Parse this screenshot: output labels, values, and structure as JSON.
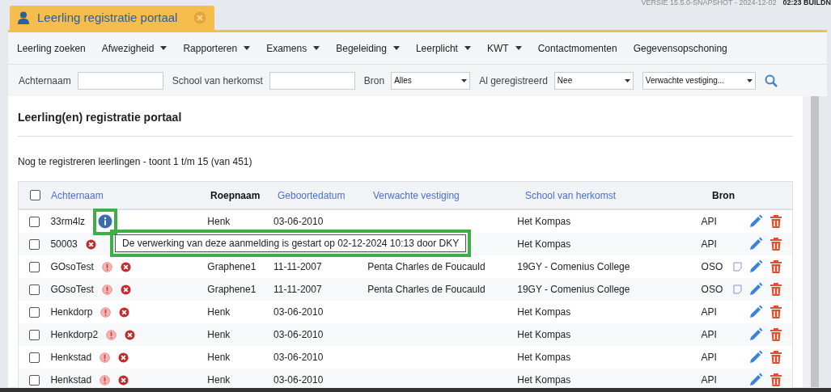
{
  "header": {
    "version": "VERSIE 15.5.0-SNAPSHOT - 2024-12-02",
    "build": "02:23 BUILDN"
  },
  "tab": {
    "title": "Leerling registratie portaal",
    "selected": true
  },
  "menu": [
    {
      "label": "Leerling zoeken",
      "dropdown": false
    },
    {
      "label": "Afwezigheid",
      "dropdown": true
    },
    {
      "label": "Rapporteren",
      "dropdown": true
    },
    {
      "label": "Examens",
      "dropdown": true
    },
    {
      "label": "Begeleiding",
      "dropdown": true
    },
    {
      "label": "Leerplicht",
      "dropdown": true
    },
    {
      "label": "KWT",
      "dropdown": true
    },
    {
      "label": "Contactmomenten",
      "dropdown": false
    },
    {
      "label": "Gegevensopschoning",
      "dropdown": false
    }
  ],
  "filters": [
    {
      "kind": "text",
      "label": "Achternaam"
    },
    {
      "kind": "text",
      "label": "School van herkomst"
    },
    {
      "kind": "select",
      "label": "Bron",
      "value": "Alles"
    },
    {
      "kind": "select",
      "label": "Al geregistreerd",
      "value": "Nee"
    },
    {
      "kind": "select",
      "value": "Verwachte vestiging..."
    }
  ],
  "panel": {
    "title": "Leerling(en) registratie portaal",
    "subtitle": "Nog te registreren leerlingen - toont 1 t/m 15 (van 451)"
  },
  "table": {
    "select_all_checked": false,
    "columns": [
      {
        "label": "Achternaam",
        "sortable": true
      },
      {
        "label": "Roepnaam",
        "sortable": false
      },
      {
        "label": "Geboortedatum",
        "sortable": true
      },
      {
        "label": "Verwachte vestiging",
        "sortable": true
      },
      {
        "label": "School van herkomst",
        "sortable": true
      },
      {
        "label": "Bron",
        "sortable": false
      }
    ],
    "rows": [
      {
        "checked": false,
        "cells": [
          "33rm4lz",
          "Henk",
          "03-06-2010",
          "",
          "Het Kompas",
          "API"
        ],
        "status_icons": [
          {
            "kind": "info",
            "highlighted": true
          }
        ],
        "note": false
      },
      {
        "checked": false,
        "cells": [
          "50003",
          "",
          "",
          "",
          "Het Kompas",
          "API"
        ],
        "status_icons": [
          {
            "kind": "error",
            "highlighted": false
          }
        ],
        "note": false
      },
      {
        "checked": false,
        "cells": [
          "GOsoTest",
          "Graphene1",
          "11-11-2007",
          "Penta Charles de Foucauld",
          "19GY - Comenius College",
          "OSO"
        ],
        "status_icons": [
          {
            "kind": "warning",
            "highlighted": false
          },
          {
            "kind": "error",
            "highlighted": false
          }
        ],
        "note": true
      },
      {
        "checked": false,
        "cells": [
          "GOsoTest",
          "Graphene1",
          "11-11-2007",
          "Penta Charles de Foucauld",
          "19GY - Comenius College",
          "OSO"
        ],
        "status_icons": [
          {
            "kind": "warning",
            "highlighted": false
          },
          {
            "kind": "error",
            "highlighted": false
          }
        ],
        "note": true
      },
      {
        "checked": false,
        "cells": [
          "Henkdorp",
          "Henk",
          "03-06-2010",
          "",
          "Het Kompas",
          "API"
        ],
        "status_icons": [
          {
            "kind": "warning",
            "highlighted": false
          },
          {
            "kind": "error",
            "highlighted": false
          }
        ],
        "note": false
      },
      {
        "checked": false,
        "cells": [
          "Henkdorp2",
          "Henk",
          "03-06-2010",
          "",
          "Het Kompas",
          "API"
        ],
        "status_icons": [
          {
            "kind": "warning",
            "highlighted": false
          },
          {
            "kind": "error",
            "highlighted": false
          }
        ],
        "note": false
      },
      {
        "checked": false,
        "cells": [
          "Henkstad",
          "Henk",
          "03-06-2010",
          "",
          "Het Kompas",
          "API"
        ],
        "status_icons": [
          {
            "kind": "warning",
            "highlighted": false
          },
          {
            "kind": "error",
            "highlighted": false
          }
        ],
        "note": false
      },
      {
        "checked": false,
        "cells": [
          "Henkstad",
          "Henk",
          "03-06-2010",
          "",
          "Het Kompas",
          "API"
        ],
        "status_icons": [
          {
            "kind": "warning",
            "highlighted": false
          },
          {
            "kind": "error",
            "highlighted": false
          }
        ],
        "note": false
      }
    ]
  },
  "tooltip": {
    "text": "De verwerking van deze aanmelding is gestart op 02-12-2024 10:13 door DKY",
    "highlighted": true
  }
}
